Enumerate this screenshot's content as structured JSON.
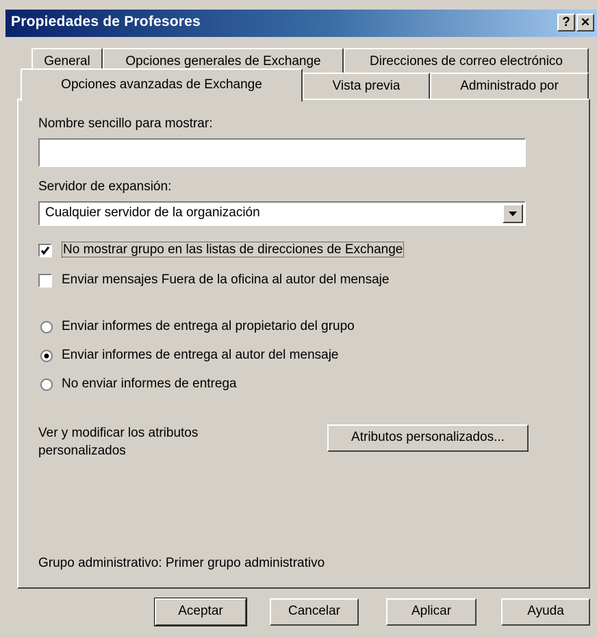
{
  "window": {
    "title": "Propiedades de Profesores",
    "help_glyph": "?",
    "close_glyph": "✕"
  },
  "tabs": {
    "row1": [
      "General",
      "Opciones generales de Exchange",
      "Direcciones de correo electrónico"
    ],
    "row2": [
      "Opciones avanzadas de Exchange",
      "Vista previa",
      "Administrado por"
    ],
    "active": "Opciones avanzadas de Exchange"
  },
  "form": {
    "display_name_label": "Nombre sencillo para mostrar:",
    "display_name_value": "",
    "expansion_server_label": "Servidor de expansión:",
    "expansion_server_value": "Cualquier servidor de la organización",
    "hide_group_label": "No mostrar grupo en las listas de direcciones de Exchange",
    "hide_group_checked": true,
    "send_oof_label": "Enviar mensajes Fuera de la oficina al autor del mensaje",
    "send_oof_checked": false,
    "delivery_reports": {
      "options": [
        "Enviar informes de entrega al propietario del grupo",
        "Enviar informes de entrega al autor del mensaje",
        "No enviar informes de entrega"
      ],
      "selected_index": 1
    },
    "custom_attrs_label_line1": "Ver y modificar los atributos",
    "custom_attrs_label_line2": "personalizados",
    "custom_attrs_button": "Atributos personalizados...",
    "admin_group_text": "Grupo administrativo: Primer grupo administrativo"
  },
  "buttons": {
    "ok": "Aceptar",
    "cancel": "Cancelar",
    "apply": "Aplicar",
    "help": "Ayuda"
  }
}
